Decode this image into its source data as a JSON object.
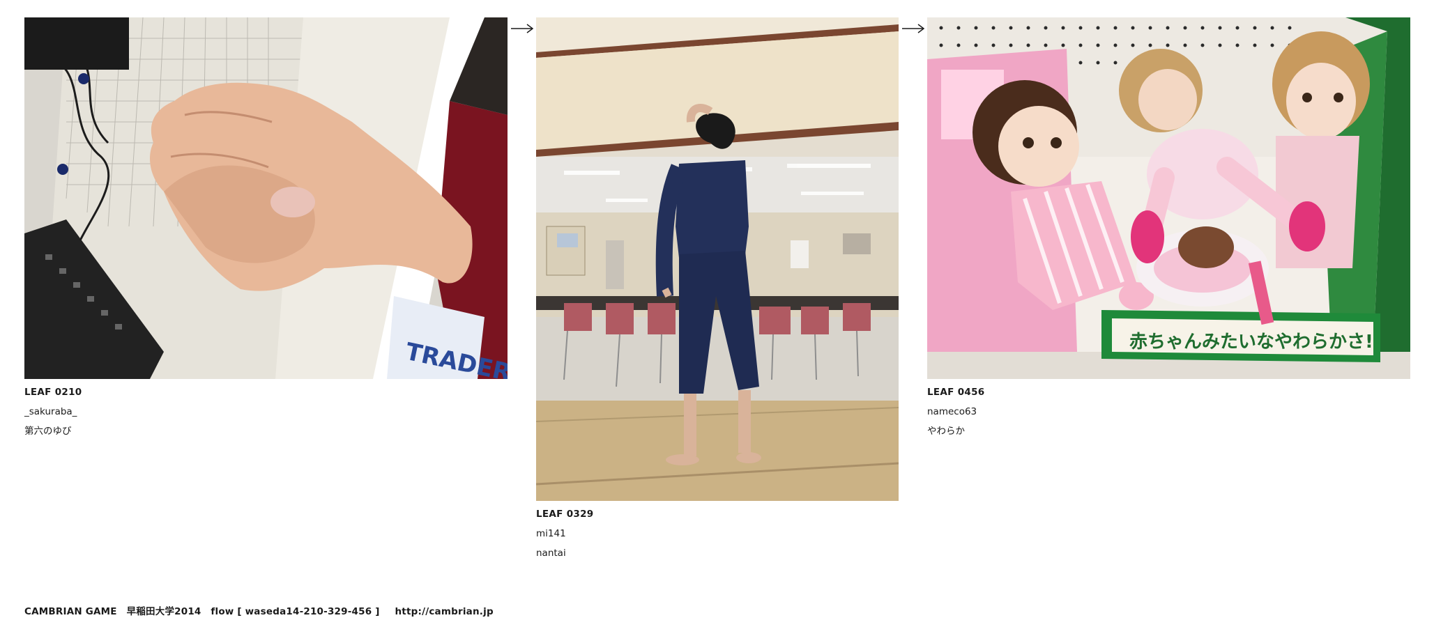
{
  "flow": {
    "leaves": [
      {
        "leaf_id": "LEAF 0210",
        "user": "_sakuraba_",
        "title": "第六のゆび",
        "photo_icon": "photo-fist-hand"
      },
      {
        "leaf_id": "LEAF 0329",
        "user": "mi141",
        "title": "nantai",
        "photo_icon": "photo-person-bending"
      },
      {
        "leaf_id": "LEAF 0456",
        "user": "nameco63",
        "title": "やわらか",
        "photo_icon": "photo-dolls-shelf"
      }
    ],
    "arrow_icon": "arrow-right-icon"
  },
  "footer": {
    "brand": "CAMBRIAN GAME",
    "event": "早稲田大学2014",
    "flow_label": "flow [ waseda14-210-329-456 ]",
    "url": "http://cambrian.jp"
  },
  "colors": {
    "text": "#1a1a1a",
    "background": "#ffffff"
  }
}
